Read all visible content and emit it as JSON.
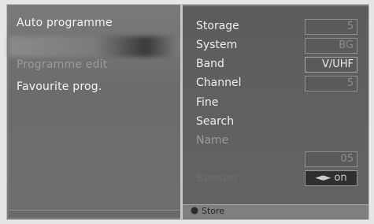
{
  "left_menu": {
    "items": [
      {
        "label": "Auto programme",
        "state": "selected"
      },
      {
        "label": "Programme edit",
        "state": "disabled"
      },
      {
        "label": "Favourite prog.",
        "state": "normal"
      }
    ]
  },
  "settings": {
    "storage": {
      "label": "Storage",
      "value": "5"
    },
    "system": {
      "label": "System",
      "value": "BG"
    },
    "band": {
      "label": "Band",
      "value": "V/UHF"
    },
    "channel": {
      "label": "Channel",
      "value": "5"
    },
    "fine": {
      "label": "Fine"
    },
    "search": {
      "label": "Search"
    },
    "name": {
      "label": "Name",
      "value": "05"
    },
    "booster": {
      "label": "Booster",
      "value": "◄► on"
    }
  },
  "footer": {
    "store_label": "Store"
  },
  "colors": {
    "panel": "#7c7c7c",
    "right_panel": "#5f5f5f",
    "frame": "#e6e6e6"
  }
}
